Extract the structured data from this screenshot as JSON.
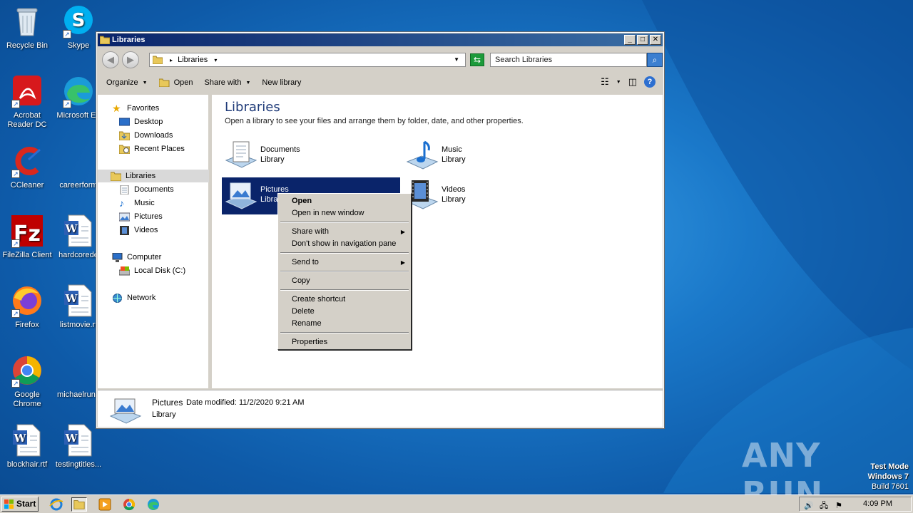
{
  "desktop": {
    "icons": [
      {
        "label": "Recycle Bin"
      },
      {
        "label": "Skype"
      },
      {
        "label": "Acrobat Reader DC"
      },
      {
        "label": "Microsoft Ed"
      },
      {
        "label": "CCleaner"
      },
      {
        "label": "careerform"
      },
      {
        "label": "FileZilla Client"
      },
      {
        "label": "hardcorede"
      },
      {
        "label": "Firefox"
      },
      {
        "label": "listmovie.rt"
      },
      {
        "label": "Google Chrome"
      },
      {
        "label": "michaelrunn"
      },
      {
        "label": "blockhair.rtf"
      },
      {
        "label": "testingtitles..."
      }
    ],
    "watermark": "ANY RUN",
    "test_mode": {
      "line1": "Test Mode",
      "line2": "Windows 7",
      "line3": "Build 7601"
    }
  },
  "window": {
    "title": "Libraries",
    "address": {
      "path": "Libraries"
    },
    "search": {
      "placeholder": "Search Libraries"
    },
    "commands": {
      "organize": "Organize",
      "open": "Open",
      "share_with": "Share with",
      "new_library": "New library"
    },
    "nav": {
      "favorites": "Favorites",
      "desktop": "Desktop",
      "downloads": "Downloads",
      "recent_places": "Recent Places",
      "libraries": "Libraries",
      "documents": "Documents",
      "music": "Music",
      "pictures": "Pictures",
      "videos": "Videos",
      "computer": "Computer",
      "local_disk": "Local Disk (C:)",
      "network": "Network"
    },
    "content": {
      "title": "Libraries",
      "subtitle": "Open a library to see your files and arrange them by folder, date, and other properties.",
      "items": [
        {
          "name": "Documents",
          "type": "Library"
        },
        {
          "name": "Music",
          "type": "Library"
        },
        {
          "name": "Pictures",
          "type": "Libra"
        },
        {
          "name": "Videos",
          "type": "Library"
        }
      ]
    },
    "details": {
      "name": "Pictures",
      "date_label": "Date modified:",
      "date_value": "11/2/2020 9:21 AM",
      "type": "Library"
    }
  },
  "context_menu": {
    "open": "Open",
    "open_new_window": "Open in new window",
    "share_with": "Share with",
    "dont_show": "Don't show in navigation pane",
    "send_to": "Send to",
    "copy": "Copy",
    "create_shortcut": "Create shortcut",
    "delete": "Delete",
    "rename": "Rename",
    "properties": "Properties"
  },
  "taskbar": {
    "start": "Start",
    "time": "4:09 PM"
  },
  "colors": {
    "title_bar": "#0a246a",
    "selection": "#0a246a",
    "chrome": "#d4d0c8"
  }
}
